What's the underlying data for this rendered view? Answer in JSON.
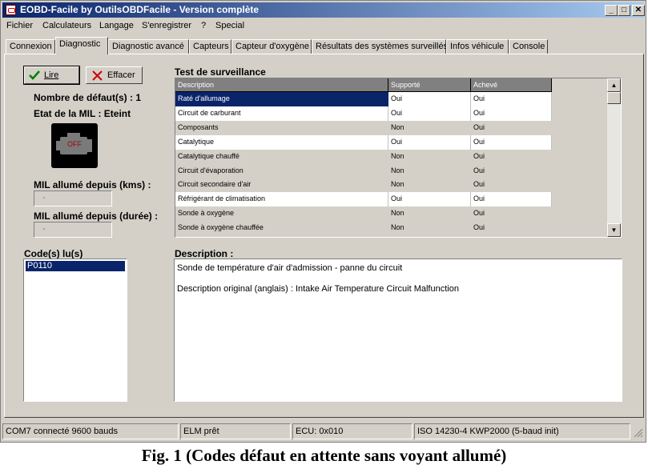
{
  "window": {
    "title": "EOBD-Facile by OutilsOBDFacile - Version complète"
  },
  "menu": [
    "Fichier",
    "Calculateurs",
    "Langage",
    "S'enregistrer",
    "?",
    "Special"
  ],
  "tabs": [
    "Connexion",
    "Diagnostic",
    "Diagnostic avancé",
    "Capteurs",
    "Capteur d'oxygène",
    "Résultats des systèmes surveillés",
    "Infos véhicule",
    "Console"
  ],
  "active_tab": "Diagnostic",
  "buttons": {
    "read": "Lire",
    "clear": "Effacer"
  },
  "fault_count_label": "Nombre de défaut(s) : 1",
  "mil_state_label": "Etat de la MIL : Eteint",
  "mil_icon_text": "OFF",
  "mil_km_label": "MIL allumé depuis (kms) :",
  "mil_km_value": "-",
  "mil_duration_label": "MIL allumé depuis (durée) :",
  "mil_duration_value": "-",
  "codes_label": "Code(s) lu(s)",
  "codes": [
    "P0110"
  ],
  "monitor": {
    "title": "Test de surveillance",
    "columns": [
      "Description",
      "Supporté",
      "Achevé"
    ],
    "rows": [
      [
        "Raté d'allumage",
        "Oui",
        "Oui"
      ],
      [
        "Circuit de carburant",
        "Oui",
        "Oui"
      ],
      [
        "Composants",
        "Non",
        "Oui"
      ],
      [
        "Catalytique",
        "Oui",
        "Oui"
      ],
      [
        "Catalytique chauffé",
        "Non",
        "Oui"
      ],
      [
        "Circuit d'évaporation",
        "Non",
        "Oui"
      ],
      [
        "Circuit secondaire d'air",
        "Non",
        "Oui"
      ],
      [
        "Réfrigérant de climatisation",
        "Oui",
        "Oui"
      ],
      [
        "Sonde à oxygène",
        "Non",
        "Oui"
      ],
      [
        "Sonde à oxygène chauffée",
        "Non",
        "Oui"
      ]
    ]
  },
  "description": {
    "label": "Description :",
    "line1": "Sonde de température d'air d'admission - panne du circuit",
    "line2": "Description original (anglais) : Intake Air Temperature Circuit Malfunction"
  },
  "status": [
    "COM7 connecté 9600 bauds",
    "ELM prêt",
    "ECU: 0x010",
    "ISO 14230-4 KWP2000 (5-baud init)"
  ],
  "caption": "Fig. 1 (Codes défaut en attente sans voyant allumé)",
  "colors": {
    "title_start": "#0a246a",
    "selected_row": "#0a246a",
    "window_bg": "#d4d0c8"
  }
}
